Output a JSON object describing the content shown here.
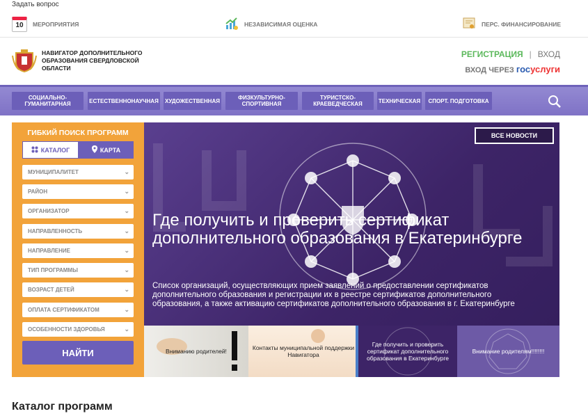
{
  "topbar": {
    "ask_question": "Задать вопрос"
  },
  "quicklinks": {
    "events": {
      "day": "10",
      "label": "Мероприятия",
      "icon": "calendar-icon"
    },
    "rating": {
      "label": "Независимая оценка",
      "icon": "chart-growth-icon"
    },
    "finance": {
      "label": "Перс. финансирование",
      "icon": "certificate-icon"
    }
  },
  "header": {
    "org_name": "Навигатор дополнительного образования Свердловской области",
    "register": "Регистрация",
    "separator": "|",
    "login": "Вход",
    "login_via": "Вход через",
    "gosuslugi_1": "гос",
    "gosuslugi_2": "услуги"
  },
  "nav": {
    "items": [
      "Социально-гуманитарная",
      "Естественнонаучная",
      "Художественная",
      "Физкультурно-спортивная",
      "Туристско-краеведческая",
      "Техническая",
      "Спорт. подготовка"
    ]
  },
  "search_panel": {
    "title": "Гибкий поиск программ",
    "tab_catalog": "Каталог",
    "tab_map": "Карта",
    "filters": [
      "Муниципалитет",
      "Район",
      "Организатор",
      "Направленность",
      "Направление",
      "Тип программы",
      "Возраст детей",
      "Оплата сертификатом",
      "Особенности здоровья"
    ],
    "find_button": "Найти"
  },
  "slider": {
    "all_news": "Все новости",
    "title": "Где получить и проверить сертификат дополнительного образования в Екатеринбурге",
    "text": "Список организаций, осуществляющих прием заявлений о предоставлении сертификатов дополнительного образования и регистрации их в реестре сертификатов дополнительного образования, а также активацию сертификатов дополнительного образования в г. Екатеринбурге",
    "thumbnails": [
      "Вниманию родителей!",
      "Контакты муниципальной поддержки Навигатора",
      "Где получить и проверить сертификат дополнительного образования в Екатеринбурге",
      "Внимание родителям!!!!!!!!"
    ]
  },
  "catalog": {
    "title": "Каталог программ"
  },
  "colors": {
    "accent": "#6c5fb9",
    "orange": "#f2a33a",
    "green": "#5bb85b"
  }
}
